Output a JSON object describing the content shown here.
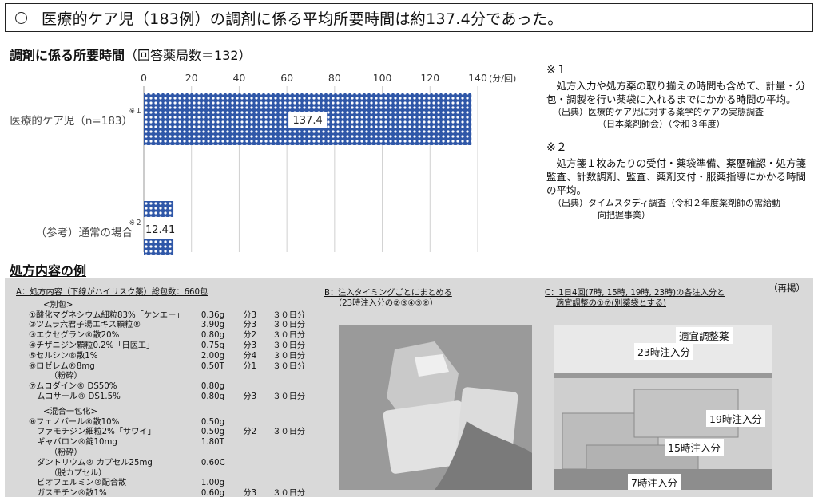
{
  "headline": "医療的ケア児（183例）の調剤に係る平均所要時間は約137.4分であった。",
  "section1": {
    "title": "調剤に係る所要時間",
    "note": "（回答薬局数＝132）"
  },
  "chart_data": {
    "type": "bar",
    "orientation": "horizontal",
    "categories": [
      "医療的ケア児（n=183）",
      "（参考）通常の場合"
    ],
    "category_marks": [
      "※１",
      "※２"
    ],
    "values": [
      137.4,
      12.41
    ],
    "data_labels": [
      "137.4",
      "12.41"
    ],
    "xlim": [
      0,
      140
    ],
    "xticks": [
      "0",
      "20",
      "40",
      "60",
      "80",
      "100",
      "120",
      "140"
    ],
    "unit": "(分/回)",
    "bar_color": "#2f57a8",
    "grid": true
  },
  "notes": [
    {
      "mark": "※１",
      "body": "処方入力や処方薬の取り揃えの時間も含めて、計量・分包・調製を行い薬袋に入れるまでにかかる時間の平均。",
      "source_1": "（出典）医療的ケア児に対する薬学的ケアの実態調査",
      "source_2": "（日本薬剤師会）（令和３年度）"
    },
    {
      "mark": "※２",
      "body": "処方箋１枚あたりの受付・薬袋準備、薬歴確認・処方箋監査、計数調剤、監査、薬剤交付・服薬指導にかかる時間の平均。",
      "source_1": "（出典）タイムスタディ調査（令和２年度薬剤師の需給動",
      "source_2": "向把握事業）"
    }
  ],
  "section2": {
    "title": "処方内容の例"
  },
  "panel": {
    "reprint": "（再掲）",
    "colA": {
      "head": "A：処方内容（下線がハイリスク薬）総包数：660包",
      "group1": "<別包>",
      "rows1": [
        {
          "name": "①酸化マグネシウム細粒83%「ケンエー」",
          "amount": "0.36g",
          "per": "分3",
          "days": "３０日分"
        },
        {
          "name": "②ツムラ六君子湯エキス顆粒®",
          "amount": "3.90g",
          "per": "分3",
          "days": "３０日分"
        },
        {
          "name": "③エクセグラン®散20%",
          "amount": "0.80g",
          "per": "分2",
          "days": "３０日分"
        },
        {
          "name": "④チザニジン顆粒0.2%「日医工」",
          "amount": "0.75g",
          "per": "分3",
          "days": "３０日分"
        },
        {
          "name": "⑤セルシン®散1%",
          "amount": "2.00g",
          "per": "分4",
          "days": "３０日分"
        },
        {
          "name": "⑥ロゼレム®8mg",
          "amount": "0.50T",
          "per": "分1",
          "days": "３０日分"
        }
      ],
      "crushed1": "（粉砕）",
      "rows1b": [
        {
          "name": "⑦ムコダイン® DS50%",
          "amount": "0.80g",
          "per": "",
          "days": ""
        },
        {
          "name": "　ムコサール® DS1.5%",
          "amount": "0.80g",
          "per": "分3",
          "days": "３０日分"
        }
      ],
      "group2": "<混合一包化>",
      "rows2": [
        {
          "name": "⑧フェノバール®散10%",
          "amount": "0.50g",
          "per": "",
          "days": ""
        },
        {
          "name": "　ファモチジン細粒2%「サワイ」",
          "amount": "0.50g",
          "per": "分2",
          "days": "３０日分"
        },
        {
          "name": "　ギャバロン®錠10mg",
          "amount": "1.80T",
          "per": "",
          "days": ""
        }
      ],
      "crushed2": "（粉砕）",
      "rows2b": [
        {
          "name": "　ダントリウム® カプセル25mg",
          "amount": "0.60C",
          "per": "",
          "days": ""
        }
      ],
      "decapsule": "（脱カプセル）",
      "rows2c": [
        {
          "name": "　ビオフェルミン®配合散",
          "amount": "1.00g",
          "per": "",
          "days": ""
        },
        {
          "name": "　ガスモチン®散1%",
          "amount": "0.60g",
          "per": "分3",
          "days": "３０日分"
        }
      ]
    },
    "colB": {
      "head": "B：注入タイミングごとにまとめる",
      "sub": "（23時注入分の②③④⑤⑧）"
    },
    "colC": {
      "head": "C：1日4回(7時, 15時, 19時, 23時)の各注入分と",
      "sub": "適宜調整の①⑦(別薬袋とする)"
    },
    "photo2_labels": [
      "適宜調整薬",
      "23時注入分",
      "19時注入分",
      "15時注入分",
      "7時注入分"
    ]
  }
}
